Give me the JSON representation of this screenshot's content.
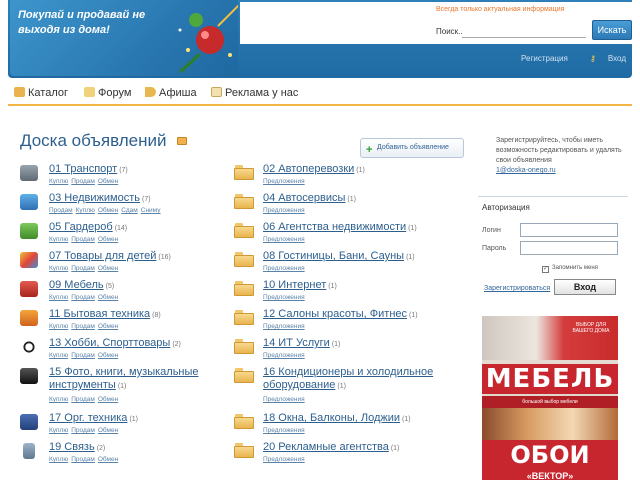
{
  "header": {
    "slogan": "Покупай и продавай не выходя из дома!",
    "notice": "Всегда только актуальная информация",
    "search_label": "Поиск...",
    "search_button": "Искать",
    "links": [
      "Регистрация",
      "Вход"
    ]
  },
  "nav": [
    "Каталог",
    "Форум",
    "Афиша",
    "Реклама у нас"
  ],
  "main": {
    "title": "Доска объявлений",
    "add_button": "Добавить объявление",
    "left": [
      {
        "name": "01 Транспорт",
        "count": "(7)",
        "subs": [
          "Куплю",
          "Продам",
          "Обмен"
        ]
      },
      {
        "name": "03 Недвижимость",
        "count": "(7)",
        "subs": [
          "Продам",
          "Куплю",
          "Обмен",
          "Сдам",
          "Сниму"
        ]
      },
      {
        "name": "05 Гардероб",
        "count": "(14)",
        "subs": [
          "Куплю",
          "Продам",
          "Обмен"
        ]
      },
      {
        "name": "07 Товары для детей",
        "count": "(16)",
        "subs": [
          "Куплю",
          "Продам",
          "Обмен"
        ]
      },
      {
        "name": "09 Мебель",
        "count": "(5)",
        "subs": [
          "Куплю",
          "Продам",
          "Обмен"
        ]
      },
      {
        "name": "11 Бытовая техника",
        "count": "(8)",
        "subs": [
          "Куплю",
          "Продам",
          "Обмен"
        ]
      },
      {
        "name": "13 Хобби, Спорттовары",
        "count": "(2)",
        "subs": [
          "Куплю",
          "Продам",
          "Обмен"
        ]
      },
      {
        "name": "15 Фото, книги, музыкальные инструменты",
        "count": "(1)",
        "subs": [
          "Куплю",
          "Продам",
          "Обмен"
        ]
      },
      {
        "name": "17 Орг. техника",
        "count": "(1)",
        "subs": [
          "Куплю",
          "Продам",
          "Обмен"
        ]
      },
      {
        "name": "19 Связь",
        "count": "(2)",
        "subs": [
          "Куплю",
          "Продам",
          "Обмен"
        ]
      }
    ],
    "right": [
      {
        "name": "02 Автоперевозки",
        "count": "(1)",
        "subs": [
          "Предложения"
        ]
      },
      {
        "name": "04 Автосервисы",
        "count": "(1)",
        "subs": [
          "Предложения"
        ]
      },
      {
        "name": "06 Агентства недвижимости",
        "count": "(1)",
        "subs": [
          "Предложения"
        ]
      },
      {
        "name": "08 Гостиницы, Бани, Сауны",
        "count": "(1)",
        "subs": [
          "Предложения"
        ]
      },
      {
        "name": "10 Интернет",
        "count": "(1)",
        "subs": [
          "Предложения"
        ]
      },
      {
        "name": "12 Салоны красоты, Фитнес",
        "count": "(1)",
        "subs": [
          "Предложения"
        ]
      },
      {
        "name": "14 ИТ Услуги",
        "count": "(1)",
        "subs": [
          "Предложения"
        ]
      },
      {
        "name": "16 Кондиционеры и холодильное оборудование",
        "count": "(1)",
        "subs": [
          "Предложения"
        ]
      },
      {
        "name": "18 Окна, Балконы, Лоджии",
        "count": "(1)",
        "subs": [
          "Предложения"
        ]
      },
      {
        "name": "20 Рекламные агентства",
        "count": "(1)",
        "subs": [
          "Предложения"
        ]
      }
    ]
  },
  "sidebar": {
    "text": "Зарегистрируйтесь, чтобы иметь возможность редактировать и удалять свои объявления",
    "email": "1@doska-onego.ru",
    "auth": {
      "title": "Авторизация",
      "login_label": "Логин",
      "password_label": "Пароль",
      "remember": "Запомнить меня",
      "register": "Зарегистрироваться",
      "button": "Вход"
    },
    "ad": {
      "promo": "ВЫБОР ДЛЯ ВАШЕГО ДОМА",
      "mebel": "МЕБЕЛЬ",
      "desc": "большой выбор мебели",
      "oboi": "ОБОИ",
      "vektor": "«ВЕКТОР»"
    }
  }
}
